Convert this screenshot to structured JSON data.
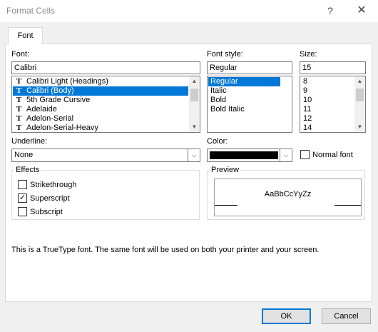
{
  "window": {
    "title": "Format Cells",
    "help_icon": "?",
    "close_icon": "✕"
  },
  "tabs": [
    {
      "label": "Font"
    }
  ],
  "font": {
    "label": "Font:",
    "value": "Calibri",
    "items": [
      "Calibri Light (Headings)",
      "Calibri (Body)",
      "5th Grade Cursive",
      "Adelaide",
      "Adelon-Serial",
      "Adelon-Serial-Heavy"
    ],
    "selected_index": 1,
    "item_icon": "truetype-icon"
  },
  "font_style": {
    "label": "Font style:",
    "value": "Regular",
    "items": [
      "Regular",
      "Italic",
      "Bold",
      "Bold Italic"
    ],
    "selected_index": 0
  },
  "size": {
    "label": "Size:",
    "value": "15",
    "items": [
      "8",
      "9",
      "10",
      "11",
      "12",
      "14"
    ]
  },
  "underline": {
    "label": "Underline:",
    "value": "None"
  },
  "color": {
    "label": "Color:",
    "swatch": "#000000"
  },
  "normal_font": {
    "label": "Normal font",
    "checked": false
  },
  "effects": {
    "title": "Effects",
    "strikethrough": {
      "label": "Strikethrough",
      "checked": false
    },
    "superscript": {
      "label": "Superscript",
      "checked": true
    },
    "subscript": {
      "label": "Subscript",
      "checked": false
    }
  },
  "preview": {
    "title": "Preview",
    "sample": "AaBbCcYyZz"
  },
  "info_text": "This is a TrueType font.  The same font will be used on both your printer and your screen.",
  "buttons": {
    "ok": "OK",
    "cancel": "Cancel"
  },
  "colors": {
    "selection": "#0078d7",
    "dialog_bg": "#f0f0f0"
  }
}
